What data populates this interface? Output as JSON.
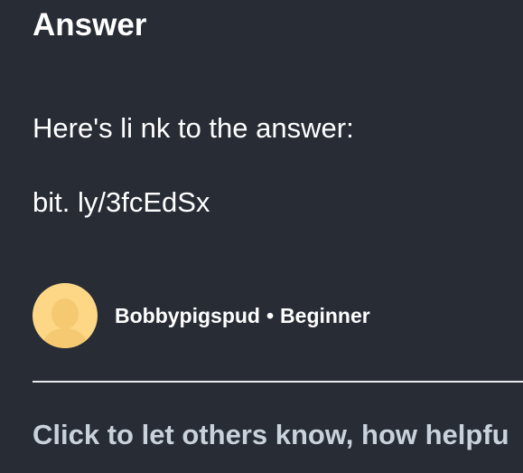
{
  "answer": {
    "heading": "Answer",
    "text_line1": "Here's li nk to the answer:",
    "text_line2": "bit. ly/3fcEdSx"
  },
  "author": {
    "name": "Bobbypigspud",
    "separator": "•",
    "rank": "Beginner",
    "avatar_icon": "user-avatar-icon"
  },
  "feedback": {
    "prompt": "Click to let others know, how helpfu"
  },
  "colors": {
    "background": "#272c35",
    "text": "#ffffff",
    "avatar": "#fdd786",
    "prompt_text": "#c9d2db",
    "divider": "#e8eaed"
  }
}
